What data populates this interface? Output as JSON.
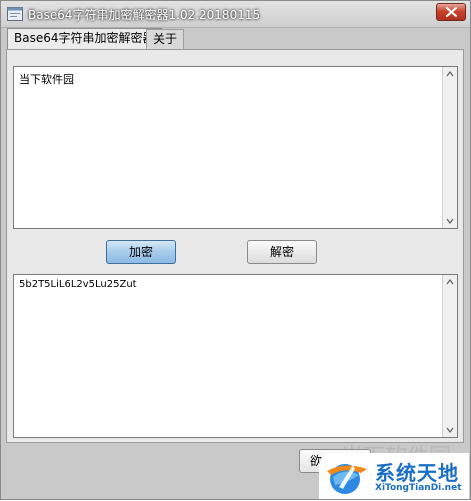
{
  "window": {
    "title": "Base64字符串加密解密器1.02.20180115"
  },
  "tabs": [
    {
      "label": "Base64字符串加密解密器",
      "active": true
    },
    {
      "label": "关于",
      "active": false
    }
  ],
  "input": {
    "value": "当下软件园"
  },
  "buttons": {
    "encrypt_label": "加密",
    "decrypt_label": "解密"
  },
  "output": {
    "value": "5b2T5LiL6L2v5Lu25Zut"
  },
  "bottom": {
    "button_label": "欲从"
  },
  "watermark": {
    "faint_text": "当下软件园",
    "brand_title": "系统天地",
    "brand_url": "XiTongTianDi.net"
  },
  "colors": {
    "accent": "#1a6fc4",
    "encrypt_button": "#a6cbec",
    "close_button": "#c8432d"
  },
  "icons": {
    "app": "app-window-icon",
    "close": "close-icon",
    "scroll_up": "scroll-up-arrow-icon",
    "scroll_down": "scroll-down-arrow-icon",
    "watermark_logo": "globe-logo-icon"
  }
}
